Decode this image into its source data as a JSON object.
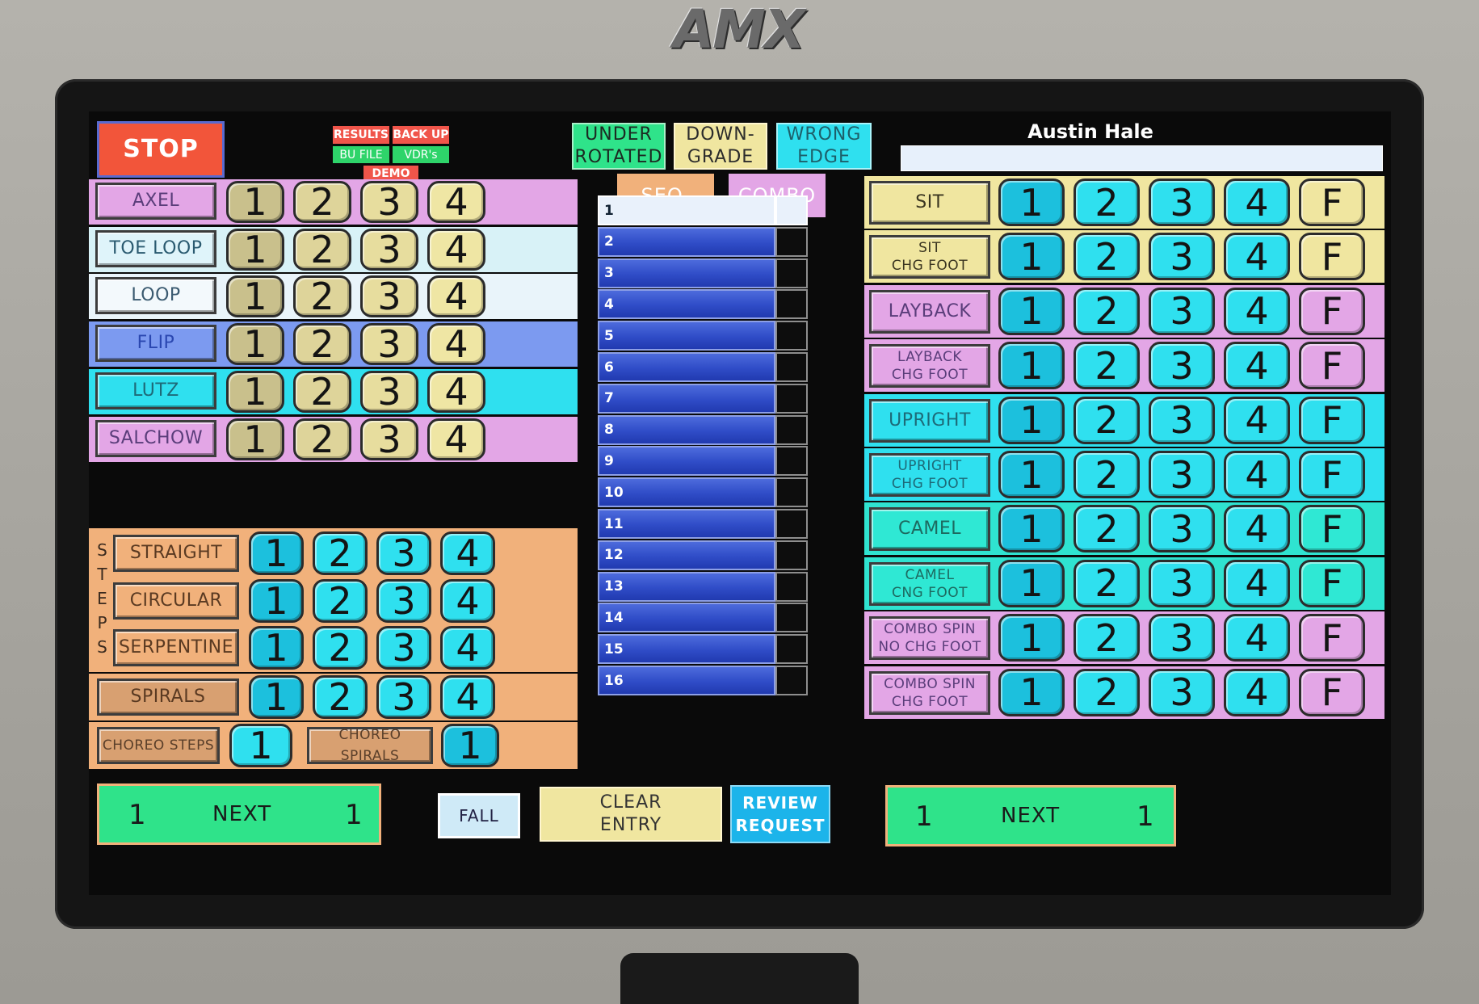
{
  "device": {
    "brand": "AMX"
  },
  "header": {
    "stop_label": "STOP",
    "results_label": "RESULTS",
    "backup_label": "BACK UP",
    "bu_file_label": "BU FILE",
    "vdrs_label": "VDR's",
    "demo_label": "DEMO",
    "under_rotated_label": "UNDER\nROTATED",
    "downgrade_label": "DOWN-\nGRADE",
    "wrong_edge_label": "WRONG\nEDGE",
    "seq_label": "SEQ.",
    "combo_label": "COMBO",
    "skater_name": "Austin Hale",
    "skater_field": ""
  },
  "jumps": [
    {
      "label": "AXEL",
      "levels": [
        "1",
        "2",
        "3",
        "4"
      ]
    },
    {
      "label": "TOE LOOP",
      "levels": [
        "1",
        "2",
        "3",
        "4"
      ]
    },
    {
      "label": "LOOP",
      "levels": [
        "1",
        "2",
        "3",
        "4"
      ]
    },
    {
      "label": "FLIP",
      "levels": [
        "1",
        "2",
        "3",
        "4"
      ]
    },
    {
      "label": "LUTZ",
      "levels": [
        "1",
        "2",
        "3",
        "4"
      ]
    },
    {
      "label": "SALCHOW",
      "levels": [
        "1",
        "2",
        "3",
        "4"
      ]
    }
  ],
  "steps": {
    "side_label": "STEPS",
    "rows": [
      {
        "label": "STRAIGHT",
        "levels": [
          "1",
          "2",
          "3",
          "4"
        ]
      },
      {
        "label": "CIRCULAR",
        "levels": [
          "1",
          "2",
          "3",
          "4"
        ]
      },
      {
        "label": "SERPENTINE",
        "levels": [
          "1",
          "2",
          "3",
          "4"
        ]
      }
    ]
  },
  "spirals": {
    "label": "SPIRALS",
    "levels": [
      "1",
      "2",
      "3",
      "4"
    ]
  },
  "choreo": {
    "steps_label": "CHOREO STEPS",
    "steps_level": "1",
    "spirals_label": "CHOREO SPIRALS",
    "spirals_level": "1"
  },
  "sequence": {
    "rows": [
      "1",
      "2",
      "3",
      "4",
      "5",
      "6",
      "7",
      "8",
      "9",
      "10",
      "11",
      "12",
      "13",
      "14",
      "15",
      "16"
    ],
    "selected": "1"
  },
  "spins": [
    {
      "label": "SIT",
      "levels": [
        "1",
        "2",
        "3",
        "4",
        "F"
      ]
    },
    {
      "label": "SIT\nCHG FOOT",
      "levels": [
        "1",
        "2",
        "3",
        "4",
        "F"
      ]
    },
    {
      "label": "LAYBACK",
      "levels": [
        "1",
        "2",
        "3",
        "4",
        "F"
      ]
    },
    {
      "label": "LAYBACK\nCHG FOOT",
      "levels": [
        "1",
        "2",
        "3",
        "4",
        "F"
      ]
    },
    {
      "label": "UPRIGHT",
      "levels": [
        "1",
        "2",
        "3",
        "4",
        "F"
      ]
    },
    {
      "label": "UPRIGHT\nCHG FOOT",
      "levels": [
        "1",
        "2",
        "3",
        "4",
        "F"
      ]
    },
    {
      "label": "CAMEL",
      "levels": [
        "1",
        "2",
        "3",
        "4",
        "F"
      ]
    },
    {
      "label": "CAMEL\nCNG FOOT",
      "levels": [
        "1",
        "2",
        "3",
        "4",
        "F"
      ]
    },
    {
      "label": "COMBO SPIN\nNO CHG FOOT",
      "levels": [
        "1",
        "2",
        "3",
        "4",
        "F"
      ]
    },
    {
      "label": "COMBO SPIN\nCHG FOOT",
      "levels": [
        "1",
        "2",
        "3",
        "4",
        "F"
      ]
    }
  ],
  "footer": {
    "left_next": {
      "left_value": "1",
      "label": "NEXT",
      "right_value": "1"
    },
    "fall_label": "FALL",
    "clear_entry_label": "CLEAR\nENTRY",
    "review_request_label": "REVIEW\nREQUEST",
    "right_next": {
      "left_value": "1",
      "label": "NEXT",
      "right_value": "1"
    }
  },
  "colors": {
    "stop": "#f2553a",
    "jump_num": "#cfc58e",
    "jump_num_light": "#efe39a",
    "cyan": "#2fe0ef",
    "cyan_dark": "#1cc0dd",
    "pink": "#e3a6e6",
    "yellow": "#f0e6a0",
    "orange": "#f1b17b",
    "green": "#2fe38a",
    "blue_strip": "#7c9af0"
  }
}
